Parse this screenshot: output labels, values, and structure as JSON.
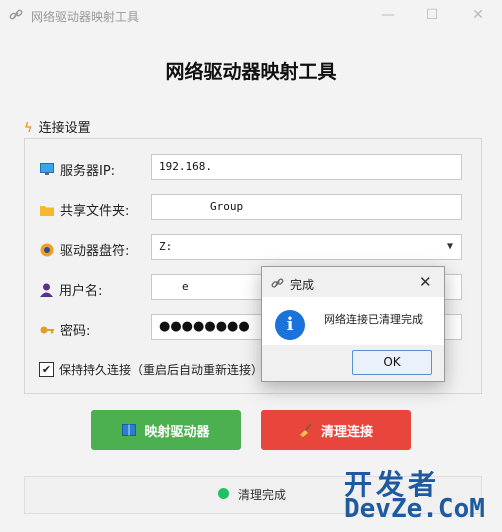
{
  "window": {
    "title": "网络驱动器映射工具"
  },
  "header": {
    "title": "网络驱动器映射工具"
  },
  "section": {
    "label": "连接设置"
  },
  "form": {
    "server_label": "服务器IP:",
    "server_value": "192.168.",
    "share_label": "共享文件夹:",
    "share_value": "Group",
    "drive_label": "驱动器盘符:",
    "drive_value": "Z:",
    "user_label": "用户名:",
    "user_value": "e",
    "password_label": "密码:",
    "password_value": "●●●●●●●●",
    "persist_label": "保持持久连接（重启后自动重新连接）",
    "persist_checked": true
  },
  "buttons": {
    "map_label": "映射驱动器",
    "clean_label": "清理连接"
  },
  "status": {
    "text": "清理完成",
    "color": "#21c065"
  },
  "dialog": {
    "title": "完成",
    "message": "网络连接已清理完成",
    "ok_label": "OK"
  },
  "watermark": {
    "line1": "开发者",
    "line2": "DevZe.CoM"
  },
  "colors": {
    "accent_green": "#4caf50",
    "accent_red": "#e8453c",
    "info_blue": "#1a73d9"
  }
}
